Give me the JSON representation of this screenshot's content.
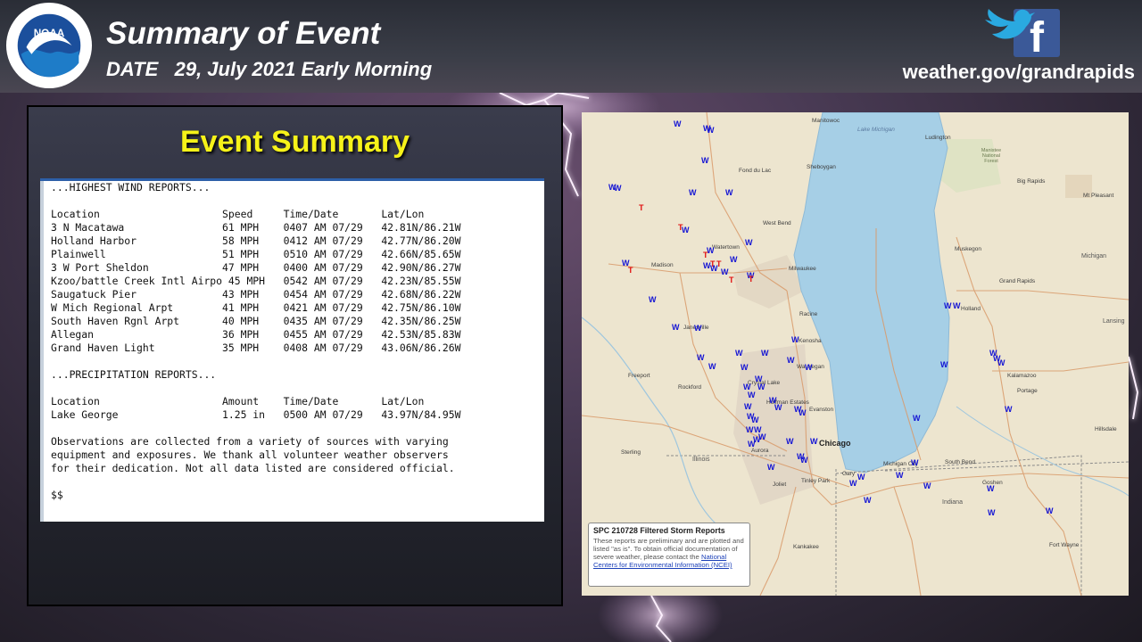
{
  "header": {
    "title": "Summary of Event",
    "date_line": "DATE   29, July 2021 Early Morning",
    "site_url": "weather.gov/grandrapids",
    "logo_text_top": "NATIONAL OCEANIC AND ATMOSPHERIC ADMINISTRATION",
    "logo_text_bottom": "U.S. DEPARTMENT OF COMMERCE",
    "logo_center": "NOAA"
  },
  "panel": {
    "heading": "Event Summary",
    "report_text": "...HIGHEST WIND REPORTS...\n\nLocation                    Speed     Time/Date       Lat/Lon\n3 N Macatawa                61 MPH    0407 AM 07/29   42.81N/86.21W\nHolland Harbor              58 MPH    0412 AM 07/29   42.77N/86.20W\nPlainwell                   51 MPH    0510 AM 07/29   42.66N/85.65W\n3 W Port Sheldon            47 MPH    0400 AM 07/29   42.90N/86.27W\nKzoo/battle Creek Intl Airpo 45 MPH   0542 AM 07/29   42.23N/85.55W\nSaugatuck Pier              43 MPH    0454 AM 07/29   42.68N/86.22W\nW Mich Regional Arpt        41 MPH    0421 AM 07/29   42.75N/86.10W\nSouth Haven Rgnl Arpt       40 MPH    0435 AM 07/29   42.35N/86.25W\nAllegan                     36 MPH    0455 AM 07/29   42.53N/85.83W\nGrand Haven Light           35 MPH    0408 AM 07/29   43.06N/86.26W\n\n...PRECIPITATION REPORTS...\n\nLocation                    Amount    Time/Date       Lat/Lon\nLake George                 1.25 in   0500 AM 07/29   43.97N/84.95W\n\nObservations are collected from a variety of sources with varying\nequipment and exposures. We thank all volunteer weather observers\nfor their dedication. Not all data listed are considered official.\n\n$$"
  },
  "map": {
    "legend_title": "SPC 210728 Filtered Storm Reports",
    "legend_body": "These reports are preliminary and are plotted and listed \"as is\". To obtain official documentation of severe weather, please contact the ",
    "legend_link": "National Centers for Environmental Information (NCEI)",
    "lake_label": "Lake Michigan",
    "wind_symbol": "W",
    "tornado_symbol": "T",
    "wind_color": "#1414d4",
    "tornado_color": "#e01010",
    "places": [
      {
        "name": "Manitowoc"
      },
      {
        "name": "Ludington"
      },
      {
        "name": "Fond du Lac"
      },
      {
        "name": "Sheboygan"
      },
      {
        "name": "Big Rapids"
      },
      {
        "name": "Mt Pleasant"
      },
      {
        "name": "West Bend"
      },
      {
        "name": "Muskegon"
      },
      {
        "name": "Watertown"
      },
      {
        "name": "Madison"
      },
      {
        "name": "Milwaukee"
      },
      {
        "name": "Michigan"
      },
      {
        "name": "Grand Rapids"
      },
      {
        "name": "Holland"
      },
      {
        "name": "Racine"
      },
      {
        "name": "Janesville"
      },
      {
        "name": "Lansing"
      },
      {
        "name": "Kenosha"
      },
      {
        "name": "Waukegan"
      },
      {
        "name": "Kalamazoo"
      },
      {
        "name": "Freeport"
      },
      {
        "name": "Portage"
      },
      {
        "name": "Rockford"
      },
      {
        "name": "Crystal Lake"
      },
      {
        "name": "Evanston"
      },
      {
        "name": "Hoffman Estates"
      },
      {
        "name": "Hillsdale"
      },
      {
        "name": "Chicago"
      },
      {
        "name": "Sterling"
      },
      {
        "name": "Aurora"
      },
      {
        "name": "Illinois"
      },
      {
        "name": "Michigan City"
      },
      {
        "name": "South Bend"
      },
      {
        "name": "Gary"
      },
      {
        "name": "Goshen"
      },
      {
        "name": "Joliet"
      },
      {
        "name": "Tinley Park"
      },
      {
        "name": "Indiana"
      },
      {
        "name": "Fort Wayne"
      },
      {
        "name": "Kankakee"
      },
      {
        "name": "Manistee National Forest"
      }
    ]
  }
}
